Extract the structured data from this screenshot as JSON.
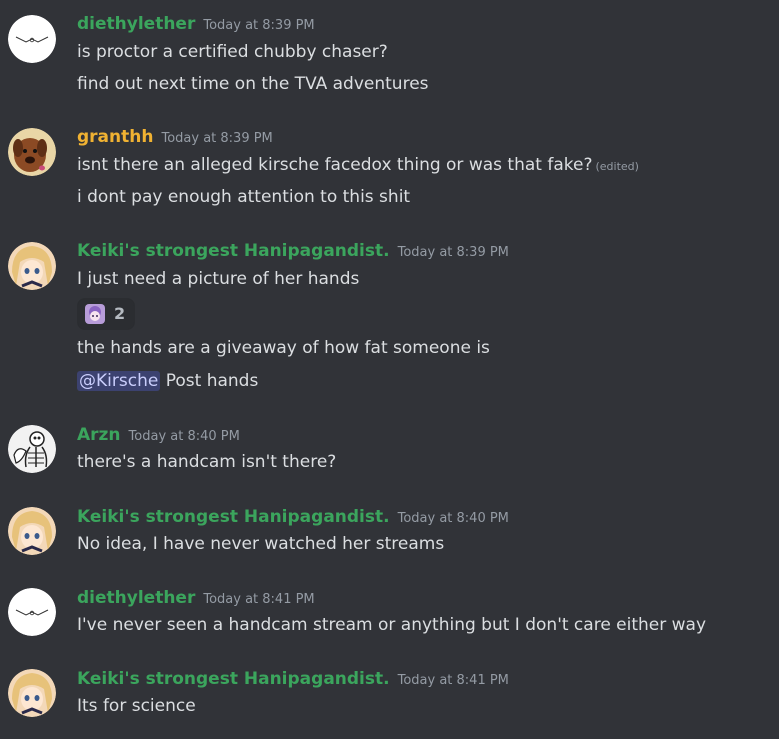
{
  "colors": {
    "background": "#313338",
    "username_green": "#3ba55d",
    "username_orange": "#f0b232",
    "timestamp": "#949ba4",
    "message_text": "#dbdee1",
    "mention_bg": "#3c4270"
  },
  "messages": [
    {
      "username": "diethylether",
      "timestamp": "Today at 8:39 PM",
      "lines": [
        "is proctor a certified chubby chaser?",
        "find out next time on the TVA adventures"
      ]
    },
    {
      "username": "granthh",
      "timestamp": "Today at 8:39 PM",
      "lines": [
        "isnt there an alleged kirsche facedox thing or was that fake?",
        "i dont pay enough attention to this shit"
      ],
      "edited": "(edited)"
    },
    {
      "username": "Keiki's strongest Hanipagandist.",
      "timestamp": "Today at 8:39 PM",
      "lines": [
        "I just need a picture of her hands",
        "the hands are a giveaway of how fat someone is",
        "Post hands"
      ],
      "reaction_count": "2",
      "mention": "@Kirsche"
    },
    {
      "username": "Arzn",
      "timestamp": "Today at 8:40 PM",
      "lines": [
        "there's a handcam isn't there?"
      ]
    },
    {
      "username": "Keiki's strongest Hanipagandist.",
      "timestamp": "Today at 8:40 PM",
      "lines": [
        "No idea, I have never watched her streams"
      ]
    },
    {
      "username": "diethylether",
      "timestamp": "Today at 8:41 PM",
      "lines": [
        "I've never seen a handcam stream or anything but I don't care either way"
      ]
    },
    {
      "username": "Keiki's strongest Hanipagandist.",
      "timestamp": "Today at 8:41 PM",
      "lines": [
        "Its for science"
      ]
    }
  ]
}
